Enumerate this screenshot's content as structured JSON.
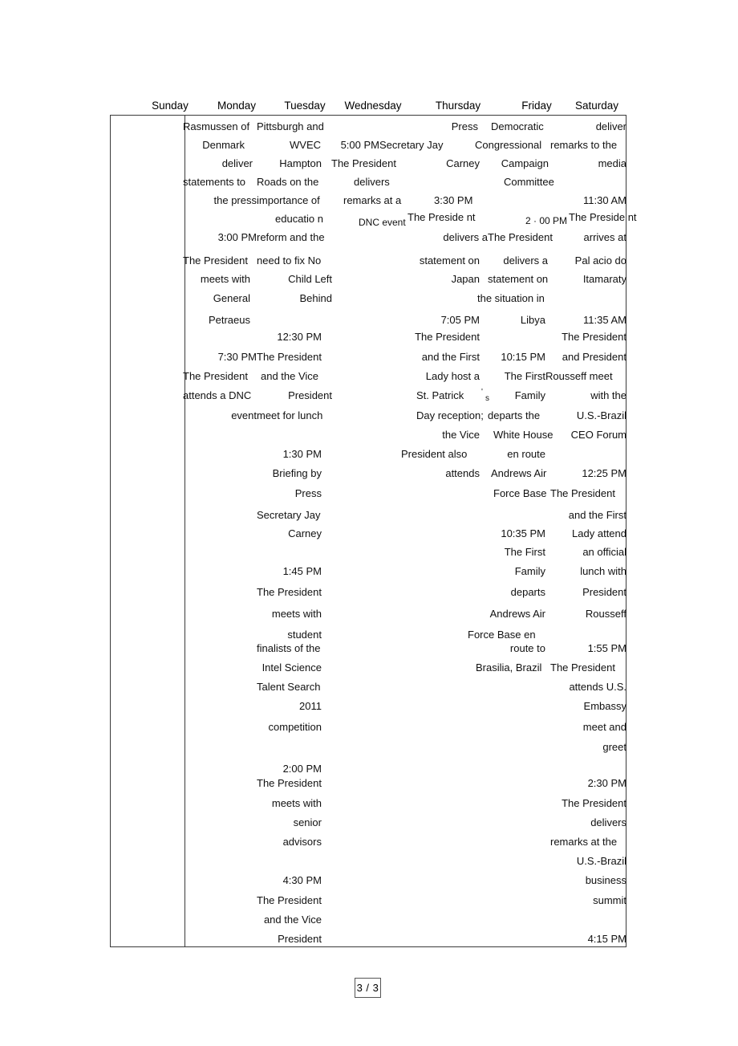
{
  "document": {
    "type": "calendar-table",
    "title": "Presidential Schedule Calendar",
    "page_label": "3 / 3"
  },
  "table": {
    "headers": [
      {
        "label": "Sunday"
      },
      {
        "label": "Monday"
      },
      {
        "label": "Tuesday"
      },
      {
        "label": "Wednesday"
      },
      {
        "label": "Thursday"
      },
      {
        "label": "Friday"
      },
      {
        "label": "Saturday"
      }
    ]
  },
  "fragments": [
    {
      "id": "f001",
      "text": "Rasmussen of"
    },
    {
      "id": "f002",
      "text": "Pittsburgh and"
    },
    {
      "id": "f003",
      "text": "Press"
    },
    {
      "id": "f004",
      "text": "Democratic"
    },
    {
      "id": "f005",
      "text": "deliver"
    },
    {
      "id": "f006",
      "text": "Denmark"
    },
    {
      "id": "f007",
      "text": "WVEC"
    },
    {
      "id": "f008",
      "text": "5:00 PM"
    },
    {
      "id": "f009",
      "text": "Secretary Jay"
    },
    {
      "id": "f010",
      "text": "Congressional"
    },
    {
      "id": "f011",
      "text": "remarks to the"
    },
    {
      "id": "f012",
      "text": "deliver"
    },
    {
      "id": "f013",
      "text": "Hampton"
    },
    {
      "id": "f014",
      "text": "The President"
    },
    {
      "id": "f015",
      "text": "Carney"
    },
    {
      "id": "f016",
      "text": "Campaign"
    },
    {
      "id": "f017",
      "text": "media"
    },
    {
      "id": "f018",
      "text": "statements to"
    },
    {
      "id": "f019",
      "text": "Roads on the"
    },
    {
      "id": "f020",
      "text": "delivers"
    },
    {
      "id": "f021",
      "text": "Committee"
    },
    {
      "id": "f022",
      "text": "the press"
    },
    {
      "id": "f023",
      "text": "importance of"
    },
    {
      "id": "f024",
      "text": "remarks at a"
    },
    {
      "id": "f025",
      "text": "3:30 PM"
    },
    {
      "id": "f026",
      "text": "11:30 AM"
    },
    {
      "id": "f027",
      "text": "educatio n"
    },
    {
      "id": "f028",
      "text": "DNC event"
    },
    {
      "id": "f029",
      "text": "The Preside nt"
    },
    {
      "id": "f030",
      "text": "2 · 00 PM"
    },
    {
      "id": "f031",
      "text": "The Preside nt"
    },
    {
      "id": "f032",
      "text": "3:00 PM"
    },
    {
      "id": "f033",
      "text": "reform and the"
    },
    {
      "id": "f034",
      "text": "delivers a"
    },
    {
      "id": "f035",
      "text": "The President"
    },
    {
      "id": "f036",
      "text": "arrives at"
    },
    {
      "id": "f037",
      "text": "The President"
    },
    {
      "id": "f038",
      "text": "need to fix No"
    },
    {
      "id": "f039",
      "text": "statement on"
    },
    {
      "id": "f040",
      "text": "delivers a"
    },
    {
      "id": "f041",
      "text": "Pal acio do"
    },
    {
      "id": "f042",
      "text": "meets with"
    },
    {
      "id": "f043",
      "text": "Child Left"
    },
    {
      "id": "f044",
      "text": "Japan"
    },
    {
      "id": "f045",
      "text": "statement on"
    },
    {
      "id": "f046",
      "text": "Itamaraty"
    },
    {
      "id": "f047",
      "text": "General"
    },
    {
      "id": "f048",
      "text": "Behind"
    },
    {
      "id": "f049",
      "text": "the situation in"
    },
    {
      "id": "f050",
      "text": "Petraeus"
    },
    {
      "id": "f051",
      "text": "7:05 PM"
    },
    {
      "id": "f052",
      "text": "Libya"
    },
    {
      "id": "f053",
      "text": "11:35 AM"
    },
    {
      "id": "f054",
      "text": "12:30 PM"
    },
    {
      "id": "f055",
      "text": "The President"
    },
    {
      "id": "f056",
      "text": "The President"
    },
    {
      "id": "f057",
      "text": "7:30 PM"
    },
    {
      "id": "f058",
      "text": "The President"
    },
    {
      "id": "f059",
      "text": "and the First"
    },
    {
      "id": "f060",
      "text": "10:15 PM"
    },
    {
      "id": "f061",
      "text": "and President"
    },
    {
      "id": "f062",
      "text": "The President"
    },
    {
      "id": "f063",
      "text": "and the Vice"
    },
    {
      "id": "f064",
      "text": "Lady host a"
    },
    {
      "id": "f065",
      "text": "The First"
    },
    {
      "id": "f066",
      "text": "Rousseff meet"
    },
    {
      "id": "f067",
      "text": "attends a DNC"
    },
    {
      "id": "f068",
      "text": "President"
    },
    {
      "id": "f069",
      "text": "St. Patrick"
    },
    {
      "id": "f070",
      "text": "'"
    },
    {
      "id": "f071",
      "text": "s"
    },
    {
      "id": "f072",
      "text": "Family"
    },
    {
      "id": "f073",
      "text": "with the"
    },
    {
      "id": "f074",
      "text": "event"
    },
    {
      "id": "f075",
      "text": "meet for lunch"
    },
    {
      "id": "f076",
      "text": "Day reception;"
    },
    {
      "id": "f077",
      "text": "departs the"
    },
    {
      "id": "f078",
      "text": "U.S.-Brazil"
    },
    {
      "id": "f079",
      "text": "the Vice"
    },
    {
      "id": "f080",
      "text": "White House"
    },
    {
      "id": "f081",
      "text": "CEO Forum"
    },
    {
      "id": "f082",
      "text": "1:30 PM"
    },
    {
      "id": "f083",
      "text": "President also"
    },
    {
      "id": "f084",
      "text": "en route"
    },
    {
      "id": "f085",
      "text": "Briefing by"
    },
    {
      "id": "f086",
      "text": "attends"
    },
    {
      "id": "f087",
      "text": "Andrews Air"
    },
    {
      "id": "f088",
      "text": "12:25 PM"
    },
    {
      "id": "f089",
      "text": "Press"
    },
    {
      "id": "f090",
      "text": "Force Base"
    },
    {
      "id": "f091",
      "text": "The President"
    },
    {
      "id": "f092",
      "text": "Secretary Jay"
    },
    {
      "id": "f093",
      "text": "and the First"
    },
    {
      "id": "f094",
      "text": "Carney"
    },
    {
      "id": "f095",
      "text": "10:35 PM"
    },
    {
      "id": "f096",
      "text": "Lady attend"
    },
    {
      "id": "f097",
      "text": "The First"
    },
    {
      "id": "f098",
      "text": "an official"
    },
    {
      "id": "f099",
      "text": "1:45 PM"
    },
    {
      "id": "f100",
      "text": "Family"
    },
    {
      "id": "f101",
      "text": "lunch with"
    },
    {
      "id": "f102",
      "text": "The President"
    },
    {
      "id": "f103",
      "text": "departs"
    },
    {
      "id": "f104",
      "text": "President"
    },
    {
      "id": "f105",
      "text": "meets with"
    },
    {
      "id": "f106",
      "text": "Andrews Air"
    },
    {
      "id": "f107",
      "text": "Rousseff"
    },
    {
      "id": "f108",
      "text": "student"
    },
    {
      "id": "f109",
      "text": "Force Base en"
    },
    {
      "id": "f110",
      "text": "finalists of the"
    },
    {
      "id": "f111",
      "text": "route to"
    },
    {
      "id": "f112",
      "text": "1:55 PM"
    },
    {
      "id": "f113",
      "text": "Intel Science"
    },
    {
      "id": "f114",
      "text": "Brasilia, Brazil"
    },
    {
      "id": "f115",
      "text": "The President"
    },
    {
      "id": "f116",
      "text": "Talent Search"
    },
    {
      "id": "f117",
      "text": "attends U.S."
    },
    {
      "id": "f118",
      "text": "2011"
    },
    {
      "id": "f119",
      "text": "Embassy"
    },
    {
      "id": "f120",
      "text": "competition"
    },
    {
      "id": "f121",
      "text": "meet and"
    },
    {
      "id": "f122",
      "text": "greet"
    },
    {
      "id": "f123",
      "text": "2:00 PM"
    },
    {
      "id": "f124",
      "text": "The President"
    },
    {
      "id": "f125",
      "text": "2:30 PM"
    },
    {
      "id": "f126",
      "text": "meets with"
    },
    {
      "id": "f127",
      "text": "The President"
    },
    {
      "id": "f128",
      "text": "senior"
    },
    {
      "id": "f129",
      "text": "delivers"
    },
    {
      "id": "f130",
      "text": "advisors"
    },
    {
      "id": "f131",
      "text": "remarks at the"
    },
    {
      "id": "f132",
      "text": "U.S.-Brazil"
    },
    {
      "id": "f133",
      "text": "4:30 PM"
    },
    {
      "id": "f134",
      "text": "business"
    },
    {
      "id": "f135",
      "text": "The President"
    },
    {
      "id": "f136",
      "text": "summit"
    },
    {
      "id": "f137",
      "text": "and the Vice"
    },
    {
      "id": "f138",
      "text": "President"
    },
    {
      "id": "f139",
      "text": "4:15 PM"
    }
  ]
}
